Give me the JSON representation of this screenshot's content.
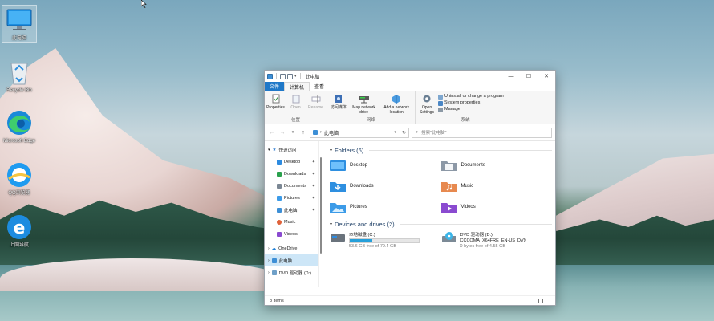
{
  "desktop": {
    "icons": [
      {
        "label": "此电脑",
        "icon": "monitor-icon"
      },
      {
        "label": "Recycle Bin",
        "icon": "recycle-bin-icon"
      },
      {
        "label": "Microsoft Edge",
        "icon": "edge-icon"
      },
      {
        "label": "QQ浏览器",
        "icon": "qq-browser-icon"
      },
      {
        "label": "上网导航",
        "icon": "ie-icon"
      }
    ]
  },
  "window": {
    "title": "此电脑",
    "controls": {
      "minimize": "—",
      "maximize": "☐",
      "close": "✕"
    },
    "tabs": {
      "file": "文件",
      "computer": "计算机",
      "view": "查看"
    },
    "ribbon": {
      "location": {
        "name": "位置",
        "properties": "Properties",
        "open": "Open",
        "rename": "Rename"
      },
      "network": {
        "name": "网络",
        "access_media": "访问媒体",
        "map_drive": "Map network drive",
        "add_location": "Add a network location"
      },
      "system": {
        "name": "系统",
        "open_settings": "Open Settings",
        "uninstall": "Uninstall or change a program",
        "system_properties": "System properties",
        "manage": "Manage"
      }
    },
    "address": {
      "path": "此电脑",
      "search_placeholder": "搜索\"此电脑\""
    },
    "nav": {
      "quick_access": "快速访问",
      "items": [
        "Desktop",
        "Downloads",
        "Documents",
        "Pictures",
        "此电脑",
        "Music",
        "Videos"
      ],
      "onedrive": "OneDrive",
      "this_pc": "此电脑",
      "dvd": "DVD 驱动器 (D:)"
    },
    "folders": {
      "header": "Folders (6)",
      "items": [
        "Desktop",
        "Documents",
        "Downloads",
        "Music",
        "Pictures",
        "Videos"
      ]
    },
    "drives": {
      "header": "Devices and drives (2)",
      "c_name": "本地磁盘 (C:)",
      "c_space": "53.6 GB free of 79.4 GB",
      "c_used_fraction": 0.325,
      "d_name": "DVD 驱动器 (D:)",
      "d_label": "CCCOMA_X64FRE_EN-US_DV9",
      "d_space": "0 bytes free of 4.55 GB"
    },
    "status": {
      "count": "8 items"
    }
  },
  "colors": {
    "accent": "#1f78c8",
    "drive_bar": "#26a0da",
    "folder": "#e8b54a"
  }
}
